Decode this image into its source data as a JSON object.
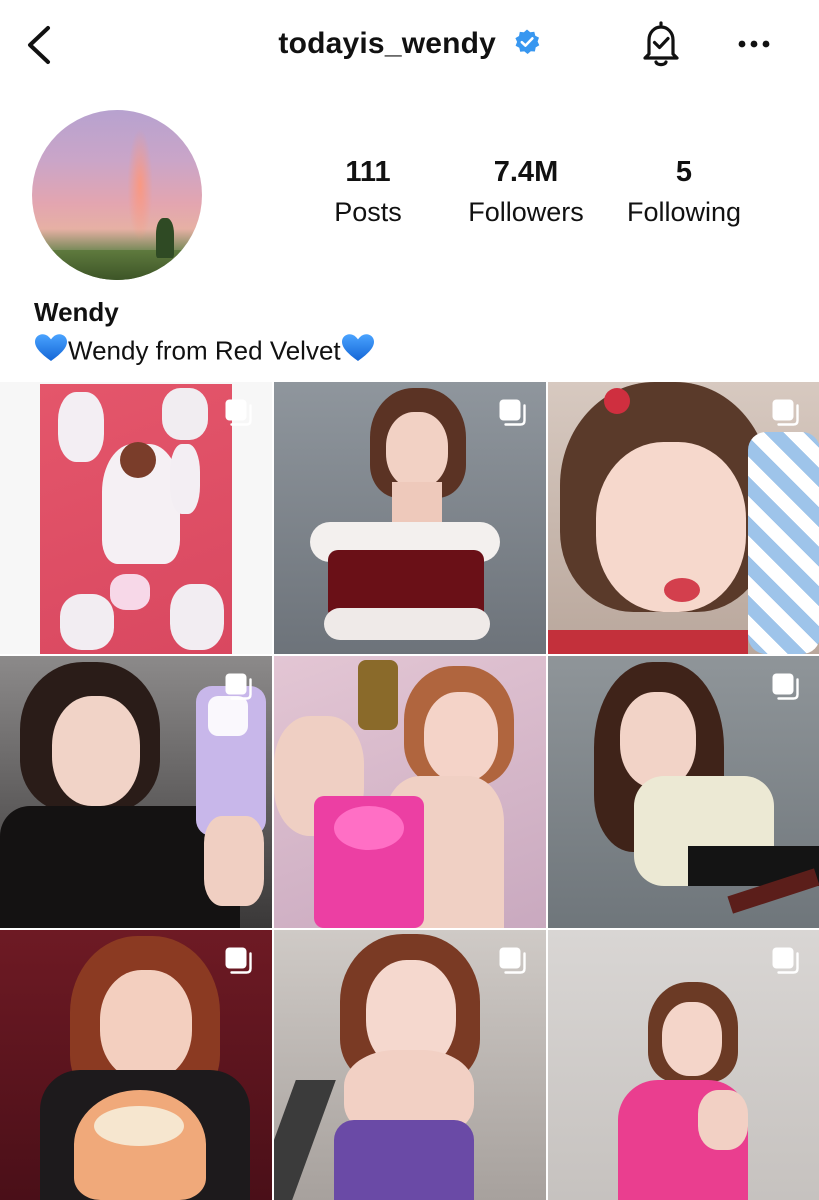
{
  "header": {
    "username": "todayis_wendy",
    "verified": true,
    "back_icon": "chevron-left-icon",
    "bell_icon": "bell-check-icon",
    "more_icon": "more-horizontal-icon"
  },
  "profile": {
    "avatar_icon": "profile-photo-rainbow-sky",
    "stats": [
      {
        "value": "111",
        "label": "Posts"
      },
      {
        "value": "7.4M",
        "label": "Followers"
      },
      {
        "value": "5",
        "label": "Following"
      }
    ],
    "name": "Wendy",
    "bio_text": "Wendy from Red Velvet",
    "bio_emoji": "blue-heart"
  },
  "colors": {
    "verified_blue": "#3897f0",
    "heart_blue": "#1d7be8",
    "text": "#111111",
    "background": "#ffffff"
  },
  "posts": [
    {
      "multi": true
    },
    {
      "multi": true
    },
    {
      "multi": true
    },
    {
      "multi": true
    },
    {
      "multi": false
    },
    {
      "multi": true
    },
    {
      "multi": true
    },
    {
      "multi": true
    },
    {
      "multi": true
    }
  ]
}
